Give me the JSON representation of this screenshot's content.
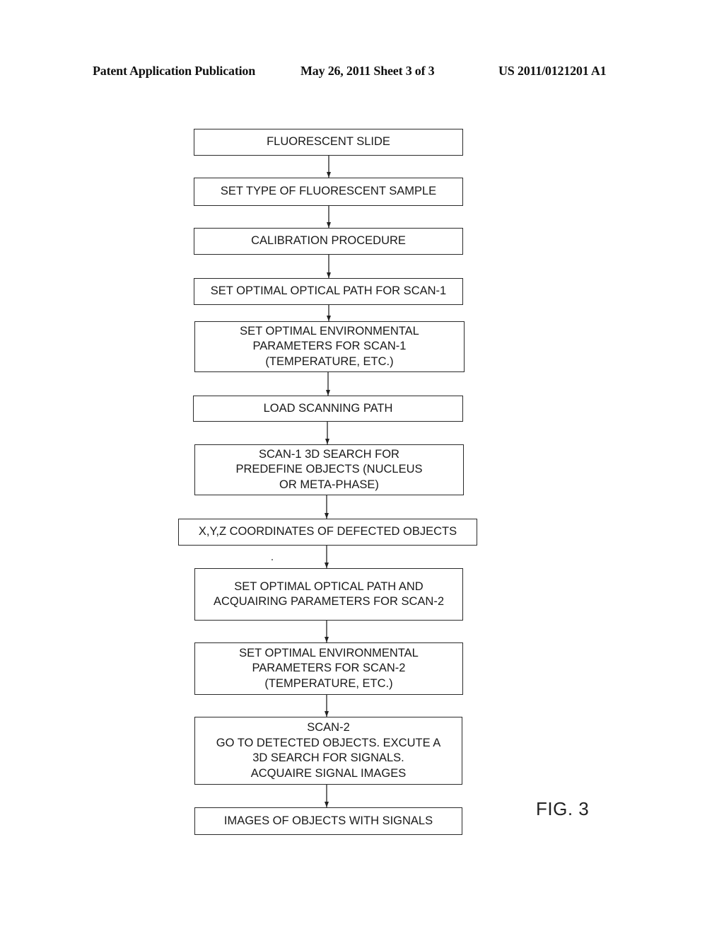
{
  "header": {
    "publication": "Patent Application Publication",
    "date_sheet": "May 26, 2011  Sheet 3 of 3",
    "number": "US 2011/0121201 A1"
  },
  "flowchart": {
    "steps": [
      {
        "text": "FLUORESCENT SLIDE"
      },
      {
        "text": "SET TYPE OF FLUORESCENT SAMPLE"
      },
      {
        "text": "CALIBRATION PROCEDURE"
      },
      {
        "text": "SET OPTIMAL OPTICAL PATH FOR SCAN-1"
      },
      {
        "text": "SET OPTIMAL ENVIRONMENTAL\nPARAMETERS FOR SCAN-1\n(TEMPERATURE, ETC.)"
      },
      {
        "text": "LOAD SCANNING PATH"
      },
      {
        "text": "SCAN-1 3D SEARCH FOR\nPREDEFINE OBJECTS (NUCLEUS\nOR META-PHASE)"
      },
      {
        "text": "X,Y,Z COORDINATES OF DEFECTED OBJECTS"
      },
      {
        "text": "SET OPTIMAL OPTICAL PATH AND\nACQUAIRING PARAMETERS FOR SCAN-2"
      },
      {
        "text": "SET OPTIMAL ENVIRONMENTAL\nPARAMETERS FOR SCAN-2\n(TEMPERATURE, ETC.)"
      },
      {
        "text": "SCAN-2\nGO TO DETECTED OBJECTS. EXCUTE A\n3D SEARCH FOR SIGNALS.\nACQUAIRE SIGNAL IMAGES"
      },
      {
        "text": "IMAGES OF OBJECTS WITH SIGNALS"
      }
    ]
  },
  "figure_label": "FIG. 3"
}
